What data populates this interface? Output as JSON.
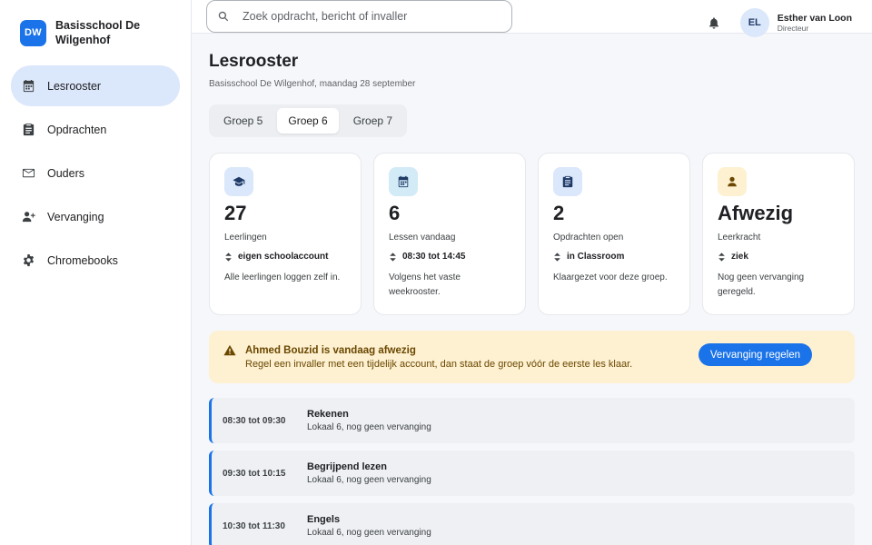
{
  "brand": {
    "initials": "DW",
    "name": "Basisschool De Wilgenhof"
  },
  "sidebar": {
    "items": [
      {
        "label": "Lesrooster",
        "icon": "calendar-icon",
        "active": true
      },
      {
        "label": "Opdrachten",
        "icon": "clipboard-icon",
        "active": false
      },
      {
        "label": "Ouders",
        "icon": "mail-icon",
        "active": false
      },
      {
        "label": "Vervanging",
        "icon": "person-add-icon",
        "active": false
      },
      {
        "label": "Chromebooks",
        "icon": "gear-icon",
        "active": false
      }
    ]
  },
  "search": {
    "placeholder": "Zoek opdracht, bericht of invaller",
    "value": ""
  },
  "user": {
    "initials": "EL",
    "name": "Esther van Loon",
    "role": "Directeur"
  },
  "page": {
    "title": "Lesrooster",
    "subtitle": "Basisschool De Wilgenhof, maandag 28 september"
  },
  "tabs": [
    {
      "label": "Groep 5",
      "active": false
    },
    {
      "label": "Groep 6",
      "active": true
    },
    {
      "label": "Groep 7",
      "active": false
    }
  ],
  "cards": [
    {
      "icon": "graduation-cap-icon",
      "icon_bg": "#dbe7fb",
      "icon_color": "#1f3a66",
      "value": "27",
      "label": "Leerlingen",
      "meta": "eigen schoolaccount",
      "desc": "Alle leerlingen loggen zelf in."
    },
    {
      "icon": "calendar-icon",
      "icon_bg": "#d3eaf7",
      "icon_color": "#1f3a66",
      "value": "6",
      "label": "Lessen vandaag",
      "meta": "08:30 tot 14:45",
      "desc": "Volgens het vaste weekrooster."
    },
    {
      "icon": "clipboard-icon",
      "icon_bg": "#dbe7fb",
      "icon_color": "#1f3a66",
      "value": "2",
      "label": "Opdrachten open",
      "meta": "in Classroom",
      "desc": "Klaargezet voor deze groep."
    },
    {
      "icon": "person-icon",
      "icon_bg": "#fdf1d2",
      "icon_color": "#6b4700",
      "value": "Afwezig",
      "label": "Leerkracht",
      "meta": "ziek",
      "desc": "Nog geen vervanging geregeld."
    }
  ],
  "alert": {
    "title": "Ahmed Bouzid is vandaag afwezig",
    "text": "Regel een invaller met een tijdelijk account, dan staat de groep vóór de eerste les klaar.",
    "button": "Vervanging regelen"
  },
  "lessons": [
    {
      "time": "08:30 tot 09:30",
      "subject": "Rekenen",
      "room": "Lokaal 6, nog geen vervanging"
    },
    {
      "time": "09:30 tot 10:15",
      "subject": "Begrijpend lezen",
      "room": "Lokaal 6, nog geen vervanging"
    },
    {
      "time": "10:30 tot 11:30",
      "subject": "Engels",
      "room": "Lokaal 6, nog geen vervanging"
    }
  ],
  "colors": {
    "accent": "#1a73e8",
    "warning_bg": "#fdf1d2",
    "warning_text": "#6b4700"
  }
}
